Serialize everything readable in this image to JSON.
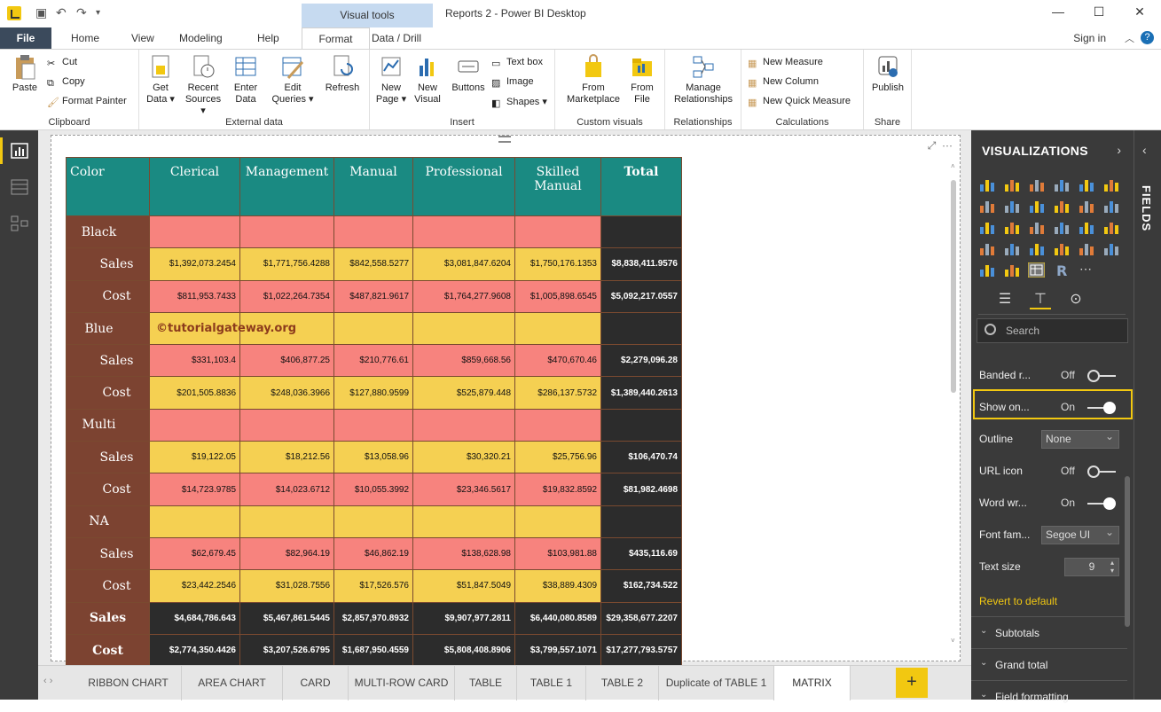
{
  "titlebar": {
    "context_tab": "Visual tools",
    "window_title": "Reports 2 - Power BI Desktop",
    "sign_in": "Sign in"
  },
  "menu": {
    "file": "File",
    "tabs": [
      "Home",
      "View",
      "Modeling",
      "Help",
      "Format",
      "Data / Drill"
    ]
  },
  "ribbon": {
    "clipboard": {
      "paste": "Paste",
      "cut": "Cut",
      "copy": "Copy",
      "format_painter": "Format Painter",
      "group": "Clipboard"
    },
    "external": {
      "get_data_1": "Get",
      "get_data_2": "Data ▾",
      "recent_1": "Recent",
      "recent_2": "Sources ▾",
      "enter_1": "Enter",
      "enter_2": "Data",
      "edit_1": "Edit",
      "edit_2": "Queries ▾",
      "refresh": "Refresh",
      "group": "External data"
    },
    "insert": {
      "newpage_1": "New",
      "newpage_2": "Page ▾",
      "newvisual_1": "New",
      "newvisual_2": "Visual",
      "buttons": "Buttons",
      "textbox": "Text box",
      "image": "Image",
      "shapes": "Shapes ▾",
      "group": "Insert"
    },
    "custom": {
      "market_1": "From",
      "market_2": "Marketplace",
      "file_1": "From",
      "file_2": "File",
      "group": "Custom visuals"
    },
    "relationships": {
      "manage_1": "Manage",
      "manage_2": "Relationships",
      "group": "Relationships"
    },
    "calculations": {
      "new_measure": "New Measure",
      "new_column": "New Column",
      "new_quick": "New Quick Measure",
      "group": "Calculations"
    },
    "share": {
      "publish": "Publish",
      "group": "Share"
    }
  },
  "matrix": {
    "headers": [
      "Color",
      "Clerical",
      "Management",
      "Manual",
      "Professional",
      "Skilled Manual",
      "Total"
    ],
    "rows": [
      {
        "label": "Black",
        "kind": "group",
        "values": [
          "",
          "",
          "",
          "",
          "",
          ""
        ]
      },
      {
        "label": "Sales",
        "kind": "sub",
        "values": [
          "$1,392,073.2454",
          "$1,771,756.4288",
          "$842,558.5277",
          "$3,081,847.6204",
          "$1,750,176.1353",
          "$8,838,411.9576"
        ]
      },
      {
        "label": "Cost",
        "kind": "sub",
        "values": [
          "$811,953.7433",
          "$1,022,264.7354",
          "$487,821.9617",
          "$1,764,277.9608",
          "$1,005,898.6545",
          "$5,092,217.0557"
        ]
      },
      {
        "label": "Blue",
        "kind": "group",
        "values": [
          "",
          "",
          "",
          "",
          "",
          ""
        ]
      },
      {
        "label": "Sales",
        "kind": "sub",
        "values": [
          "$331,103.4",
          "$406,877.25",
          "$210,776.61",
          "$859,668.56",
          "$470,670.46",
          "$2,279,096.28"
        ]
      },
      {
        "label": "Cost",
        "kind": "sub",
        "values": [
          "$201,505.8836",
          "$248,036.3966",
          "$127,880.9599",
          "$525,879.448",
          "$286,137.5732",
          "$1,389,440.2613"
        ]
      },
      {
        "label": "Multi",
        "kind": "group",
        "values": [
          "",
          "",
          "",
          "",
          "",
          ""
        ]
      },
      {
        "label": "Sales",
        "kind": "sub",
        "values": [
          "$19,122.05",
          "$18,212.56",
          "$13,058.96",
          "$30,320.21",
          "$25,756.96",
          "$106,470.74"
        ]
      },
      {
        "label": "Cost",
        "kind": "sub",
        "values": [
          "$14,723.9785",
          "$14,023.6712",
          "$10,055.3992",
          "$23,346.5617",
          "$19,832.8592",
          "$81,982.4698"
        ]
      },
      {
        "label": "NA",
        "kind": "group",
        "values": [
          "",
          "",
          "",
          "",
          "",
          ""
        ]
      },
      {
        "label": "Sales",
        "kind": "sub",
        "values": [
          "$62,679.45",
          "$82,964.19",
          "$46,862.19",
          "$138,628.98",
          "$103,981.88",
          "$435,116.69"
        ]
      },
      {
        "label": "Cost",
        "kind": "sub",
        "values": [
          "$23,442.2546",
          "$31,028.7556",
          "$17,526.576",
          "$51,847.5049",
          "$38,889.4309",
          "$162,734.522"
        ]
      },
      {
        "label": "Sales",
        "kind": "total",
        "values": [
          "$4,684,786.643",
          "$5,467,861.5445",
          "$2,857,970.8932",
          "$9,907,977.2811",
          "$6,440,080.8589",
          "$29,358,677.2207"
        ]
      },
      {
        "label": "Cost",
        "kind": "total",
        "values": [
          "$2,774,350.4426",
          "$3,207,526.6795",
          "$1,687,950.4559",
          "$5,808,408.8906",
          "$3,799,557.1071",
          "$17,277,793.5757"
        ]
      }
    ],
    "watermark": "©tutorialgateway.org"
  },
  "pages": [
    "RIBBON CHART",
    "AREA CHART",
    "CARD",
    "MULTI-ROW CARD",
    "TABLE",
    "TABLE 1",
    "TABLE 2",
    "Duplicate of TABLE 1",
    "MATRIX"
  ],
  "active_page": "MATRIX",
  "viz": {
    "title": "VISUALIZATIONS",
    "search_placeholder": "Search",
    "props": {
      "banded_label": "Banded r...",
      "banded_val": "Off",
      "show_label": "Show on...",
      "show_val": "On",
      "outline_label": "Outline",
      "outline_val": "None",
      "url_label": "URL icon",
      "url_val": "Off",
      "word_label": "Word wr...",
      "word_val": "On",
      "font_label": "Font fam...",
      "font_val": "Segoe UI",
      "size_label": "Text size",
      "size_val": "9"
    },
    "revert": "Revert to default",
    "sections": [
      "Subtotals",
      "Grand total",
      "Field formatting"
    ]
  },
  "fields_label": "FIELDS",
  "colors": {
    "teal": "#1a8a82",
    "brown": "#7c4331",
    "pink": "#f7837e",
    "yellow": "#f5d052",
    "dark": "#2c2c2c",
    "accent": "#f2c811"
  }
}
